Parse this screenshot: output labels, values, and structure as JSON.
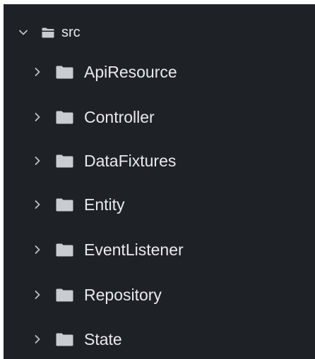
{
  "colors": {
    "panel_background": "#1e2227",
    "text": "#e8eaed",
    "chevron": "#bfc3c9",
    "folder": "#c9ccd1"
  },
  "tree": {
    "root": {
      "label": "src",
      "expanded": true,
      "icon": "folder-open-icon",
      "chevron": "chevron-down-icon"
    },
    "children": [
      {
        "label": "ApiResource",
        "expanded": false,
        "icon": "folder-icon",
        "chevron": "chevron-right-icon"
      },
      {
        "label": "Controller",
        "expanded": false,
        "icon": "folder-icon",
        "chevron": "chevron-right-icon"
      },
      {
        "label": "DataFixtures",
        "expanded": false,
        "icon": "folder-icon",
        "chevron": "chevron-right-icon"
      },
      {
        "label": "Entity",
        "expanded": false,
        "icon": "folder-icon",
        "chevron": "chevron-right-icon"
      },
      {
        "label": "EventListener",
        "expanded": false,
        "icon": "folder-icon",
        "chevron": "chevron-right-icon"
      },
      {
        "label": "Repository",
        "expanded": false,
        "icon": "folder-icon",
        "chevron": "chevron-right-icon"
      },
      {
        "label": "State",
        "expanded": false,
        "icon": "folder-icon",
        "chevron": "chevron-right-icon"
      }
    ]
  }
}
